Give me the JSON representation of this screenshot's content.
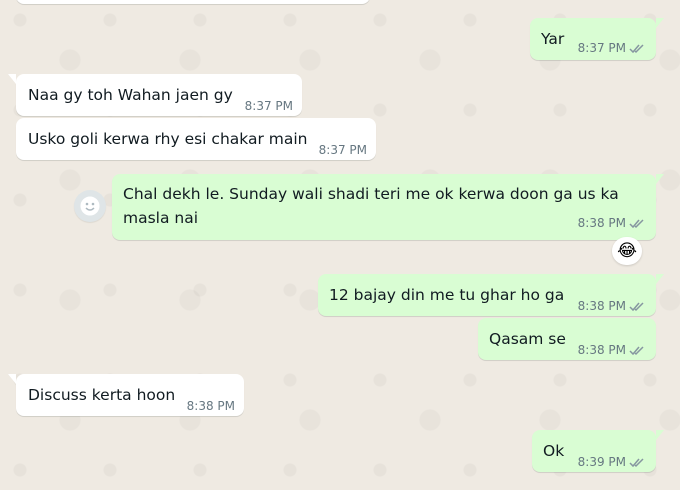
{
  "messages": [
    {
      "text": "Yar",
      "time": "8:37 PM"
    },
    {
      "text": "Naa gy toh Wahan jaen gy",
      "time": "8:37 PM"
    },
    {
      "text": "Usko goli kerwa rhy esi chakar main",
      "time": "8:37 PM"
    },
    {
      "text": "Chal dekh le. Sunday wali shadi teri me ok kerwa doon ga us ka masla nai",
      "time": "8:38 PM",
      "reaction": "😂",
      "avatar_icon": "smiley-icon"
    },
    {
      "text": "12 bajay din me tu ghar ho ga",
      "time": "8:38 PM"
    },
    {
      "text": "Qasam se",
      "time": "8:38 PM"
    },
    {
      "text": "Discuss kerta hoon",
      "time": "8:38 PM"
    },
    {
      "text": "Ok",
      "time": "8:39 PM"
    }
  ],
  "colors": {
    "background": "#efeae2",
    "incoming_bubble": "#ffffff",
    "outgoing_bubble": "#d9fdd3",
    "timestamp": "#667781",
    "read_ticks": "#8696a0"
  }
}
